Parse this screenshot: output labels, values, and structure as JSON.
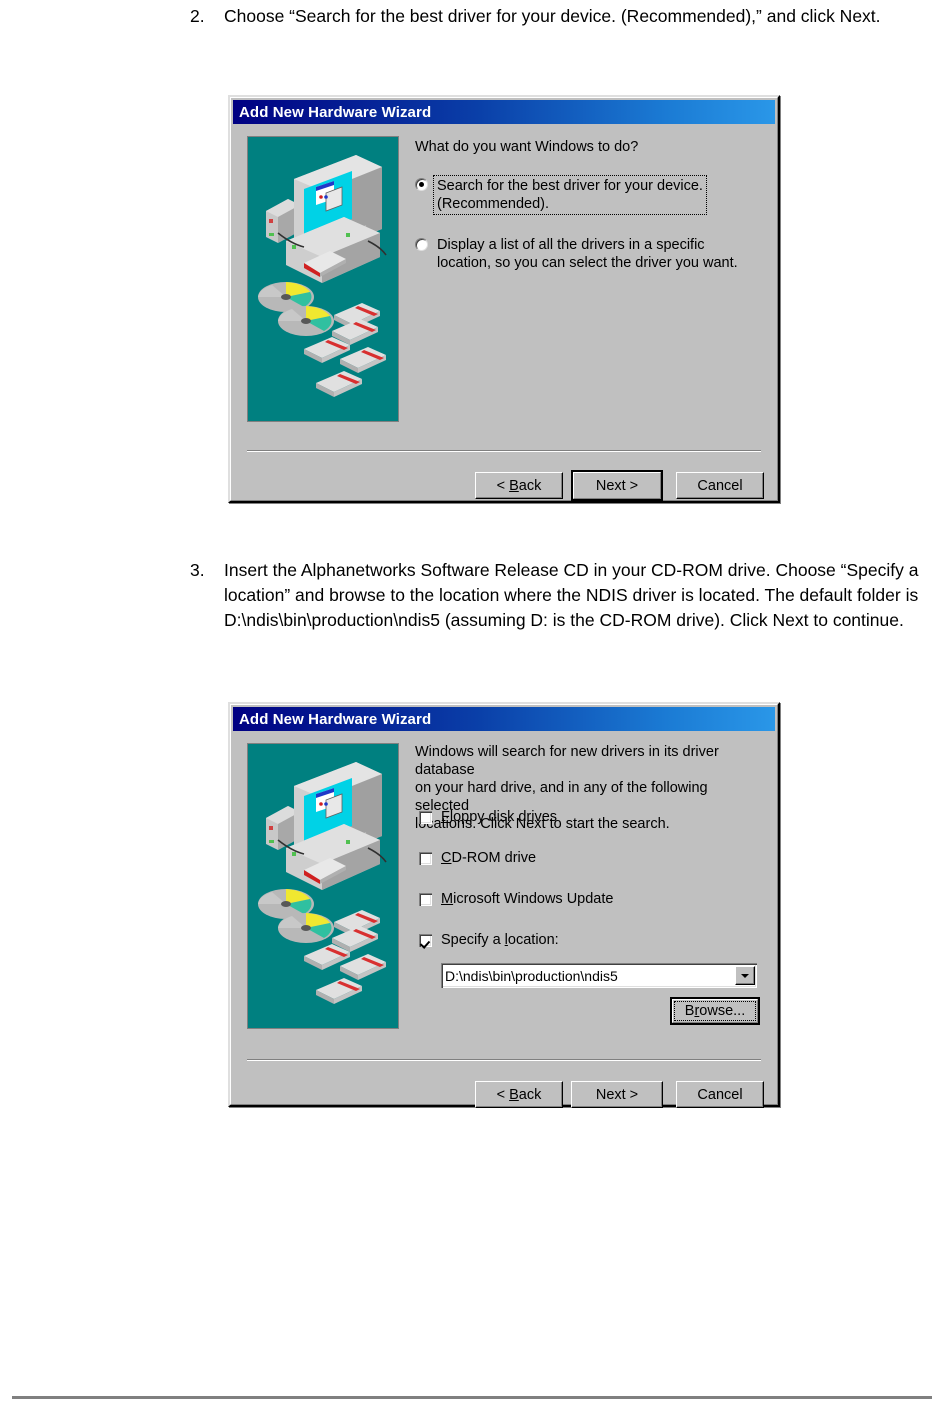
{
  "document": {
    "steps": [
      {
        "number": "2.",
        "text": "Choose “Search for the best driver for your device. (Recommended),” and click Next."
      },
      {
        "number": "3.",
        "text": "Insert the Alphanetworks Software Release CD in your CD-ROM drive. Choose “Specify a location” and browse to the location where the NDIS driver is located. The default folder is D:\\ndis\\bin\\production\\ndis5 (assuming D: is the CD-ROM drive). Click Next to continue."
      }
    ]
  },
  "colors": {
    "dialog_face": "#c0c0c0",
    "titlebar_start": "#000082",
    "titlebar_end": "#2a97e8",
    "art_background": "#008080",
    "screen_cyan": "#00d2e6",
    "page_rule": "#808080"
  },
  "dialog1": {
    "title": "Add New Hardware Wizard",
    "prompt": "What do you want Windows to do?",
    "options": [
      {
        "line1": "Search for the best driver for your device.",
        "line2": "(Recommended).",
        "selected": true,
        "focused": true
      },
      {
        "line1": "Display a list of all the drivers in a specific",
        "line2": "location, so you can select the driver you want.",
        "selected": false,
        "focused": false
      }
    ],
    "buttons": {
      "back": "< Back",
      "back_accel": "B",
      "next": "Next >",
      "cancel": "Cancel",
      "default": "next"
    }
  },
  "dialog2": {
    "title": "Add New Hardware Wizard",
    "prompt_line1": "Windows will search for new drivers in its driver database",
    "prompt_line2": "on your hard drive, and in any of the following selected",
    "prompt_line3": "locations. Click Next to start the search.",
    "checkboxes": [
      {
        "accel": "F",
        "rest": "loppy disk drives",
        "checked": false
      },
      {
        "accel": "C",
        "rest": "D-ROM drive",
        "checked": false
      },
      {
        "accel": "M",
        "rest": "icrosoft Windows Update",
        "checked": false
      },
      {
        "pre": "Specify a ",
        "accel": "l",
        "rest": "ocation:",
        "checked": true
      }
    ],
    "location_value": "D:\\ndis\\bin\\production\\ndis5",
    "browse_button": {
      "pre": "B",
      "accel": "r",
      "rest": "owse..."
    },
    "buttons": {
      "back": "< Back",
      "back_accel": "B",
      "next": "Next >",
      "cancel": "Cancel",
      "default": "none"
    }
  }
}
